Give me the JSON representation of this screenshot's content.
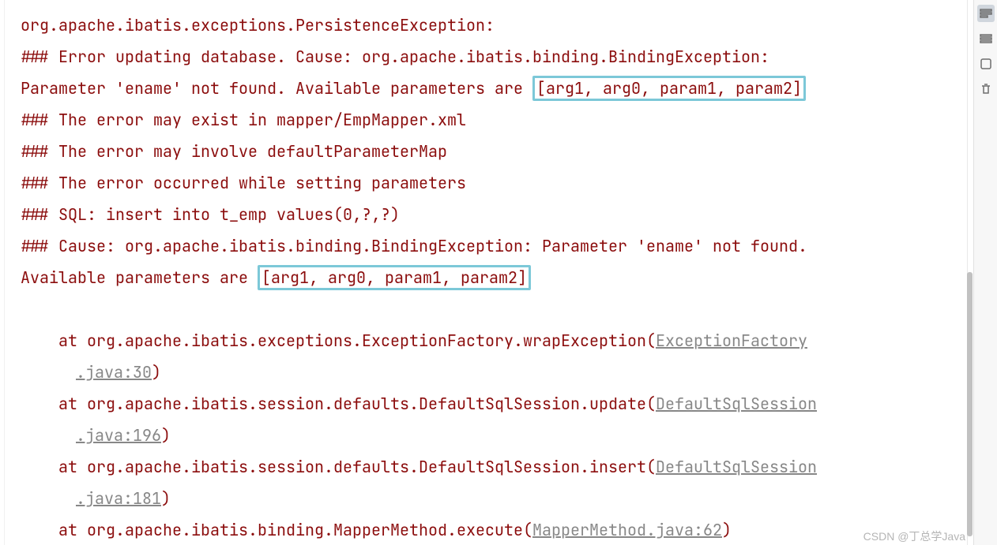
{
  "exception": {
    "line1": "org.apache.ibatis.exceptions.PersistenceException: ",
    "line2a": "### Error updating database.  Cause: org.apache.ibatis.binding.BindingException:",
    "line2b_pre": " Parameter 'ename' not found. Available parameters are ",
    "hl1": "[arg1, arg0, param1, param2]",
    "line3": "### The error may exist in mapper/EmpMapper.xml",
    "line4": "### The error may involve defaultParameterMap",
    "line5": "### The error occurred while setting parameters",
    "line6": "### SQL: insert into t_emp values(0,?,?)",
    "line7a": "### Cause: org.apache.ibatis.binding.BindingException: Parameter 'ename' not found.",
    "line7b_pre": " Available parameters are ",
    "hl2": "[arg1, arg0, param1, param2]"
  },
  "stack": [
    {
      "at": "    at org.apache.ibatis.exceptions.ExceptionFactory.wrapException(",
      "link": "ExceptionFactory.java:30",
      "after": ")",
      "break_before_link_idx": 0,
      "link_pre": "ExceptionFactory",
      "link_post": ".java:30"
    },
    {
      "at": "    at org.apache.ibatis.session.defaults.DefaultSqlSession.update(",
      "link": "DefaultSqlSession.java:196",
      "after": ")",
      "link_pre": "DefaultSqlSession",
      "link_post": ".java:196"
    },
    {
      "at": "    at org.apache.ibatis.session.defaults.DefaultSqlSession.insert(",
      "link": "DefaultSqlSession.java:181",
      "after": ")",
      "link_pre": "DefaultSqlSession",
      "link_post": ".java:181"
    },
    {
      "at": "    at org.apache.ibatis.binding.MapperMethod.execute(",
      "link": "MapperMethod.java:62",
      "after": ")",
      "link_pre": "MapperMethod.java:62",
      "link_post": ""
    }
  ],
  "watermark": "CSDN @丁总学Java"
}
